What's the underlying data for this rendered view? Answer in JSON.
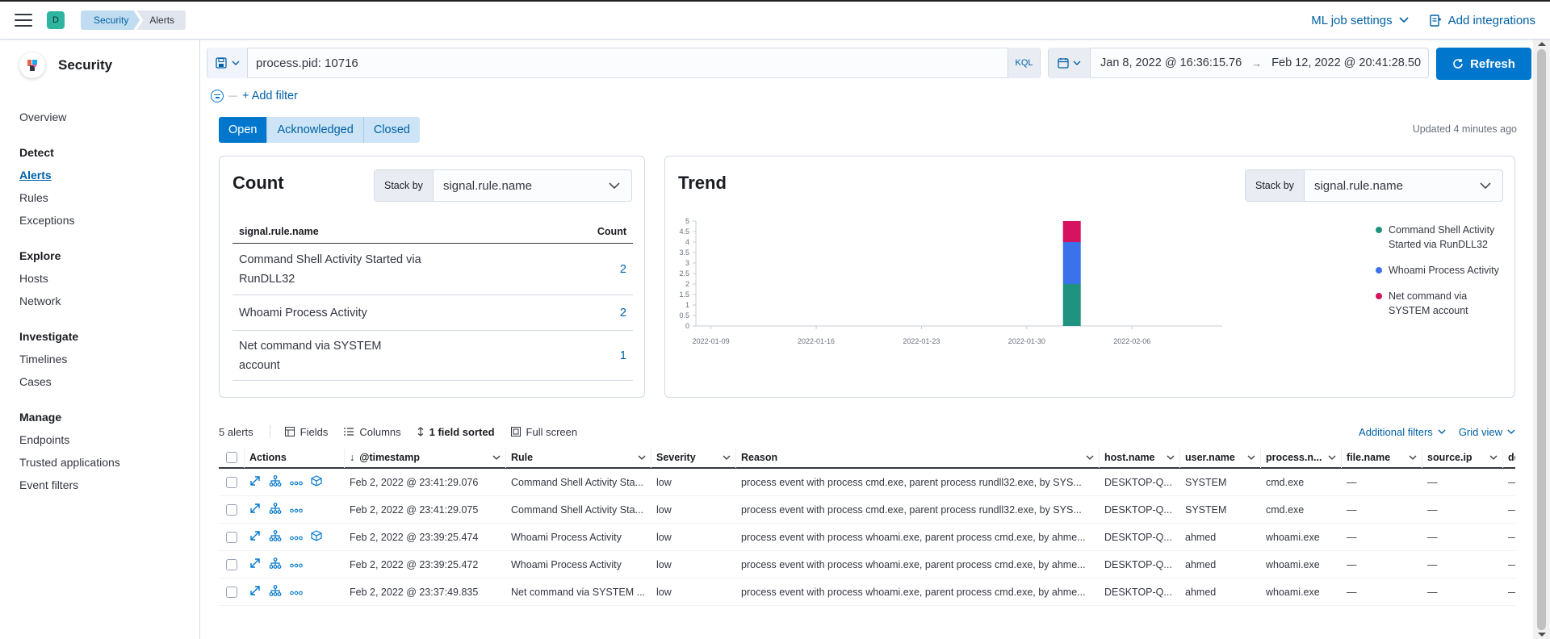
{
  "header": {
    "space_initial": "D",
    "breadcrumbs": [
      "Security",
      "Alerts"
    ],
    "ml_job_settings": "ML job settings",
    "add_integrations": "Add integrations"
  },
  "sidebar": {
    "title": "Security",
    "overview": "Overview",
    "groups": [
      {
        "heading": "Detect",
        "items": [
          "Alerts",
          "Rules",
          "Exceptions"
        ]
      },
      {
        "heading": "Explore",
        "items": [
          "Hosts",
          "Network"
        ]
      },
      {
        "heading": "Investigate",
        "items": [
          "Timelines",
          "Cases"
        ]
      },
      {
        "heading": "Manage",
        "items": [
          "Endpoints",
          "Trusted applications",
          "Event filters"
        ]
      }
    ]
  },
  "query": {
    "text": "process.pid: 10716",
    "language": "KQL",
    "date_start": "Jan 8, 2022 @ 16:36:15.76",
    "date_end": "Feb 12, 2022 @ 20:41:28.50",
    "refresh_label": "Refresh",
    "add_filter": "+ Add filter"
  },
  "status_tabs": [
    "Open",
    "Acknowledged",
    "Closed"
  ],
  "updated": "Updated 4 minutes ago",
  "count_panel": {
    "title": "Count",
    "stack_by_label": "Stack by",
    "stack_by_value": "signal.rule.name",
    "col_name": "signal.rule.name",
    "col_count": "Count",
    "rows": [
      {
        "name": "Command Shell Activity Started via RunDLL32",
        "count": "2"
      },
      {
        "name": "Whoami Process Activity",
        "count": "2"
      },
      {
        "name": "Net command via SYSTEM account",
        "count": "1"
      }
    ]
  },
  "trend_panel": {
    "title": "Trend",
    "stack_by_label": "Stack by",
    "stack_by_value": "signal.rule.name"
  },
  "chart_data": {
    "type": "bar",
    "stacked": true,
    "x_ticks": [
      "2022-01-09",
      "2022-01-16",
      "2022-01-23",
      "2022-01-30",
      "2022-02-06"
    ],
    "y_ticks": [
      "0",
      "0.5",
      "1",
      "1.5",
      "2",
      "2.5",
      "3",
      "3.5",
      "4",
      "4.5",
      "5"
    ],
    "ylim": [
      0,
      5
    ],
    "xlim": [
      "2022-01-08",
      "2022-02-12"
    ],
    "bar_date": "2022-02-02",
    "series": [
      {
        "name": "Command Shell Activity Started via RunDLL32",
        "value": 2,
        "color": "#209280"
      },
      {
        "name": "Whoami Process Activity",
        "value": 2,
        "color": "#3b72eb"
      },
      {
        "name": "Net command via SYSTEM account",
        "value": 1,
        "color": "#d6135e"
      }
    ],
    "legend_position": "right"
  },
  "toolbar": {
    "count": "5 alerts",
    "fields": "Fields",
    "columns": "Columns",
    "sorted": "1 field sorted",
    "fullscreen": "Full screen",
    "additional_filters": "Additional filters",
    "grid_view": "Grid view"
  },
  "grid": {
    "columns": [
      "Actions",
      "@timestamp",
      "Rule",
      "Severity",
      "Reason",
      "host.name",
      "user.name",
      "process.n...",
      "file.name",
      "source.ip",
      "de"
    ],
    "rows": [
      {
        "timestamp": "Feb 2, 2022 @ 23:41:29.076",
        "rule": "Command Shell Activity Sta...",
        "severity": "low",
        "reason": "process event with process cmd.exe, parent process rundll32.exe, by SYS...",
        "host": "DESKTOP-Q...",
        "user": "SYSTEM",
        "process": "cmd.exe",
        "file": "—",
        "source": "—",
        "de": "—",
        "extra_icon": true
      },
      {
        "timestamp": "Feb 2, 2022 @ 23:41:29.075",
        "rule": "Command Shell Activity Sta...",
        "severity": "low",
        "reason": "process event with process cmd.exe, parent process rundll32.exe, by SYS...",
        "host": "DESKTOP-Q...",
        "user": "SYSTEM",
        "process": "cmd.exe",
        "file": "—",
        "source": "—",
        "de": "—",
        "extra_icon": false
      },
      {
        "timestamp": "Feb 2, 2022 @ 23:39:25.474",
        "rule": "Whoami Process Activity",
        "severity": "low",
        "reason": "process event with process whoami.exe, parent process cmd.exe, by ahme...",
        "host": "DESKTOP-Q...",
        "user": "ahmed",
        "process": "whoami.exe",
        "file": "—",
        "source": "—",
        "de": "—",
        "extra_icon": true
      },
      {
        "timestamp": "Feb 2, 2022 @ 23:39:25.472",
        "rule": "Whoami Process Activity",
        "severity": "low",
        "reason": "process event with process whoami.exe, parent process cmd.exe, by ahme...",
        "host": "DESKTOP-Q...",
        "user": "ahmed",
        "process": "whoami.exe",
        "file": "—",
        "source": "—",
        "de": "—",
        "extra_icon": false
      },
      {
        "timestamp": "Feb 2, 2022 @ 23:37:49.835",
        "rule": "Net command via SYSTEM ...",
        "severity": "low",
        "reason": "process event with process whoami.exe, parent process cmd.exe, by ahme...",
        "host": "DESKTOP-Q...",
        "user": "ahmed",
        "process": "whoami.exe",
        "file": "—",
        "source": "—",
        "de": "—",
        "extra_icon": false
      }
    ]
  }
}
